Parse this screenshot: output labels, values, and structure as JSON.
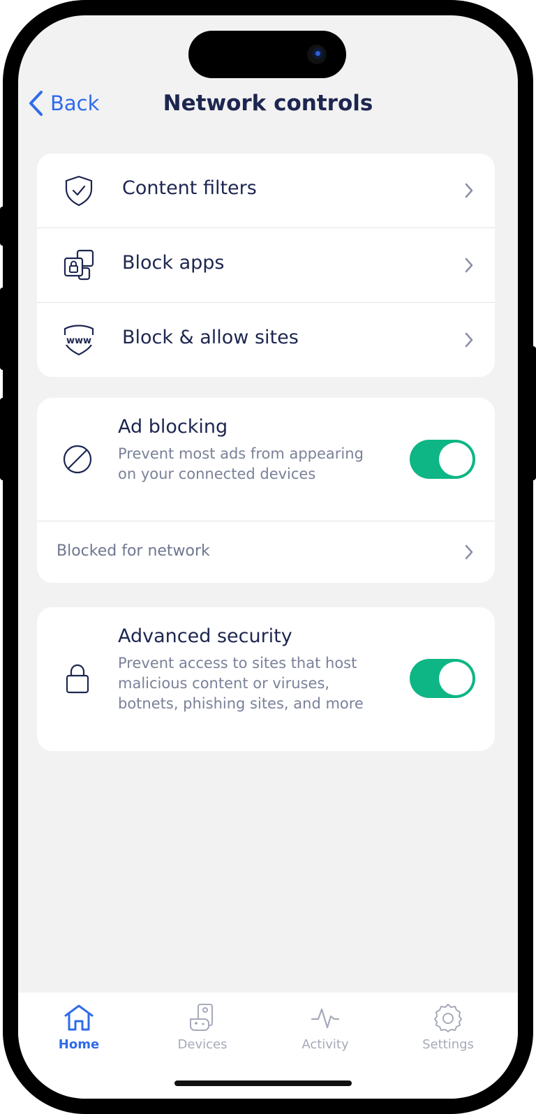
{
  "header": {
    "back_label": "Back",
    "title": "Network controls"
  },
  "nav_card": {
    "items": [
      {
        "label": "Content filters",
        "icon": "shield-check-icon"
      },
      {
        "label": "Block apps",
        "icon": "app-lock-icon"
      },
      {
        "label": "Block & allow sites",
        "icon": "www-shield-icon"
      }
    ]
  },
  "ad_blocking": {
    "title": "Ad blocking",
    "description": "Prevent most ads from appearing on your connected devices",
    "enabled": true,
    "icon": "block-circle-icon",
    "sub_row_label": "Blocked for network"
  },
  "advanced_security": {
    "title": "Advanced security",
    "description": "Prevent access to sites that host malicious content or viruses, botnets, phishing sites, and more",
    "enabled": true,
    "icon": "padlock-icon"
  },
  "tab_bar": {
    "tabs": [
      {
        "label": "Home",
        "icon": "home-icon",
        "active": true
      },
      {
        "label": "Devices",
        "icon": "devices-icon",
        "active": false
      },
      {
        "label": "Activity",
        "icon": "activity-icon",
        "active": false
      },
      {
        "label": "Settings",
        "icon": "settings-icon",
        "active": false
      }
    ]
  },
  "colors": {
    "accent": "#2f6bea",
    "toggle_on": "#0db684",
    "text_primary": "#1d2650",
    "text_secondary": "#7a8199",
    "background": "#f2f2f2"
  }
}
